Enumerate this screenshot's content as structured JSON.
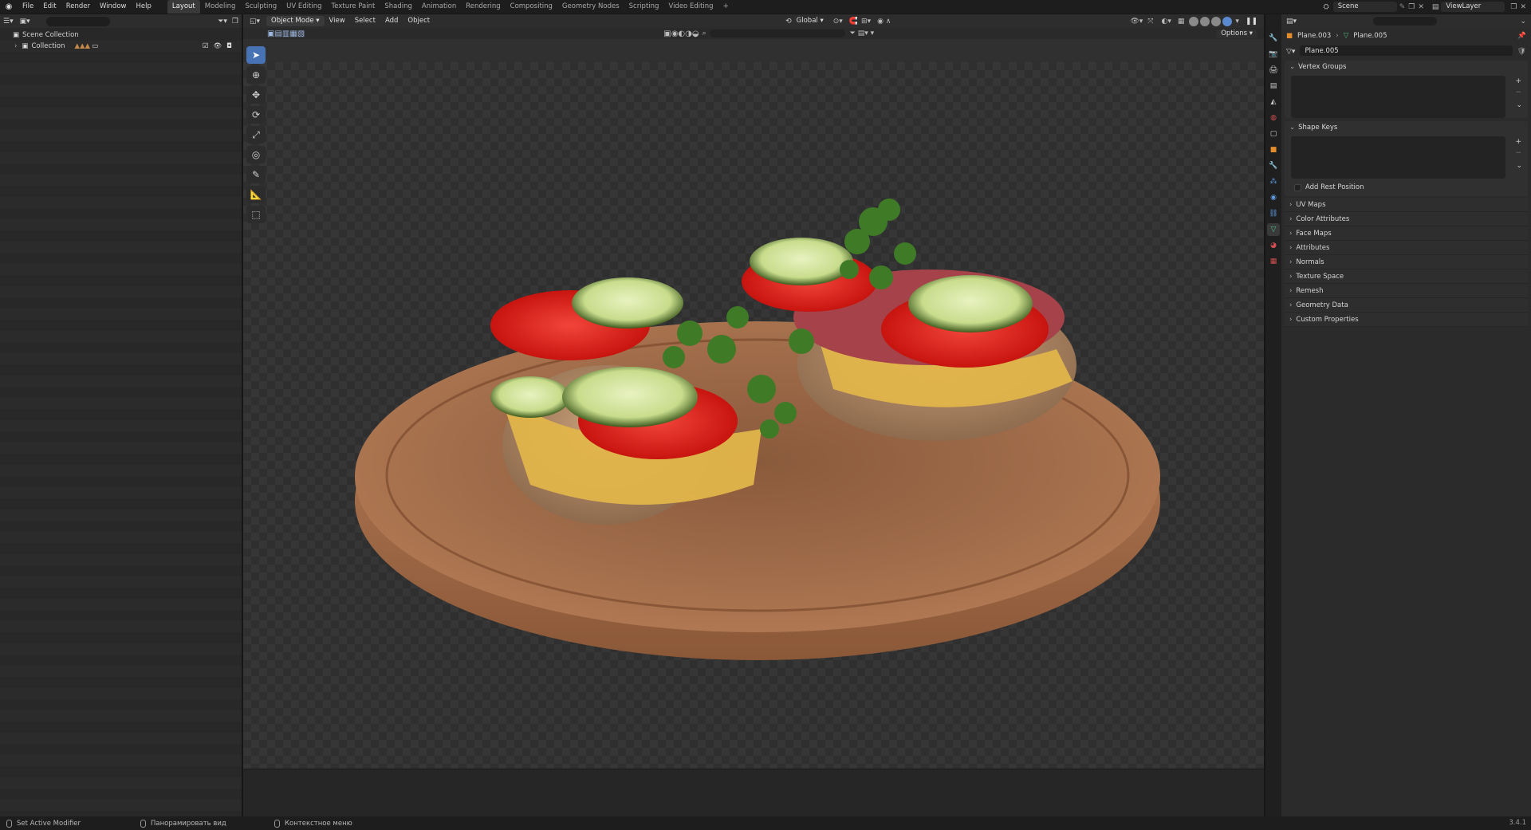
{
  "topbar": {
    "menus": [
      "File",
      "Edit",
      "Render",
      "Window",
      "Help"
    ],
    "workspaces": [
      "Layout",
      "Modeling",
      "Sculpting",
      "UV Editing",
      "Texture Paint",
      "Shading",
      "Animation",
      "Rendering",
      "Compositing",
      "Geometry Nodes",
      "Scripting",
      "Video Editing"
    ],
    "active_workspace": "Layout",
    "add_workspace": "+",
    "scene": "Scene",
    "view_layer": "ViewLayer"
  },
  "outliner": {
    "rows": [
      {
        "label": "Scene Collection"
      },
      {
        "label": "Collection"
      }
    ]
  },
  "viewport": {
    "mode": "Object Mode",
    "menus": [
      "View",
      "Select",
      "Add",
      "Object"
    ],
    "transform_orientation": "Global",
    "options_label": "Options"
  },
  "properties": {
    "object_name": "Plane.003",
    "mesh_name": "Plane.005",
    "data_name": "Plane.005",
    "panels": {
      "vertex_groups": "Vertex Groups",
      "shape_keys": "Shape Keys",
      "add_rest_position": "Add Rest Position"
    },
    "collapsed_panels": [
      "UV Maps",
      "Color Attributes",
      "Face Maps",
      "Attributes",
      "Normals",
      "Texture Space",
      "Remesh",
      "Geometry Data",
      "Custom Properties"
    ]
  },
  "statusbar": {
    "left": "Set Active Modifier",
    "middle": "Панорамировать вид",
    "right": "Контекстное меню",
    "version": "3.4.1"
  },
  "colors": {
    "accent": "#4772b3",
    "viewport_bg": "#303030",
    "panel_bg": "#2b2b2b"
  }
}
